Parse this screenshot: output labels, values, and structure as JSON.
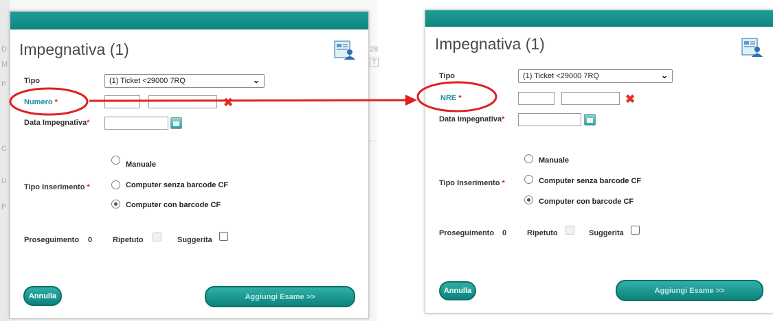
{
  "left_dialog": {
    "title": "Impegnativa (1)",
    "tipo_label": "Tipo",
    "tipo_value": "(1) Ticket <29000 7RQ",
    "numero_label": "Numero",
    "required_mark": "*",
    "data_label": "Data Impegnativa",
    "options": [
      "Manuale",
      "Computer senza barcode CF",
      "Computer con barcode CF"
    ],
    "selected_option": 2,
    "tipo_inserimento_label": "Tipo Inserimento",
    "proseguimento_label": "Proseguimento",
    "proseguimento_value": "0",
    "ripetuto_label": "Ripetuto",
    "suggerita_label": "Suggerita",
    "annulla_label": "Annulla",
    "aggiungi_label": "Aggiungi Esame >>"
  },
  "right_dialog": {
    "title": "Impegnativa (1)",
    "tipo_label": "Tipo",
    "tipo_value": "(1) Ticket <29000 7RQ",
    "numero_label": "NRE",
    "required_mark": "*",
    "data_label": "Data Impegnativa",
    "options": [
      "Manuale",
      "Computer senza barcode CF",
      "Computer con barcode CF"
    ],
    "selected_option": 2,
    "tipo_inserimento_label": "Tipo Inserimento",
    "proseguimento_label": "Proseguimento",
    "proseguimento_value": "0",
    "ripetuto_label": "Ripetuto",
    "suggerita_label": "Suggerita",
    "annulla_label": "Annulla",
    "aggiungi_label": "Aggiungi Esame >>"
  },
  "background": {
    "letters": [
      "D",
      "M",
      "P",
      "C",
      "U",
      "P",
      "28",
      "T"
    ]
  },
  "colors": {
    "titlebar": "#12918b",
    "accent_teal": "#1d8e9b",
    "required": "#d9261c",
    "annotation": "#e02020",
    "clear_icon": "#e03222"
  },
  "icons": {
    "document": "document-person-icon",
    "clear": "clear-x-icon",
    "calendar": "calendar-icon",
    "dropdown": "chevron-down-icon"
  }
}
